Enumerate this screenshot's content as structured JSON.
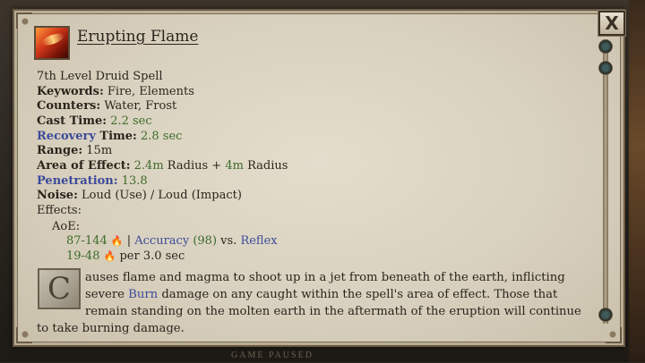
{
  "spell": {
    "name": "Erupting Flame",
    "level_line": "7th Level Druid Spell",
    "keywords_label": "Keywords:",
    "keywords": "Fire, Elements",
    "counters_label": "Counters:",
    "counters": "Water, Frost",
    "cast_time_label": "Cast Time:",
    "cast_time": "2.2 sec",
    "recovery_label_a": "Recovery",
    "recovery_label_b": " Time:",
    "recovery_time": "2.8 sec",
    "range_label": "Range:",
    "range": "15m",
    "aoe_label": "Area of Effect:",
    "aoe_value_a": "2.4m",
    "aoe_text_a": " Radius + ",
    "aoe_value_b": "4m",
    "aoe_text_b": " Radius",
    "penetration_label": "Penetration:",
    "penetration": "13.8",
    "noise_label": "Noise:",
    "noise": "Loud (Use) / Loud (Impact)",
    "effects_label": "Effects:",
    "aoe_sub_label": "AoE:",
    "damage": "87-144",
    "separator": "|",
    "accuracy_label": "Accuracy",
    "accuracy_value": "(98)",
    "vs_text": "vs.",
    "defense": "Reflex",
    "dot_damage": "19-48",
    "dot_interval": "per 3.0 sec",
    "description_cap": "C",
    "description_first": "auses flame and magma to shoot up in a jet from beneath of the earth, inflicting",
    "description_second_a": "severe ",
    "description_burn": "Burn",
    "description_second_b": " damage on any caught within the spell's area of effect.  Those that",
    "description_third": "remain standing on the molten earth in the aftermath of the eruption will continue",
    "description_fourth": "to take burning damage."
  },
  "ui": {
    "close_label": "X",
    "flame_icon": "fire-icon"
  },
  "background": {
    "bottom_text": "GAME PAUSED"
  },
  "colors": {
    "positive_value": "#3c6a2a",
    "keyword_link": "#3b4a9a",
    "parchment": "#d9d1bf"
  }
}
